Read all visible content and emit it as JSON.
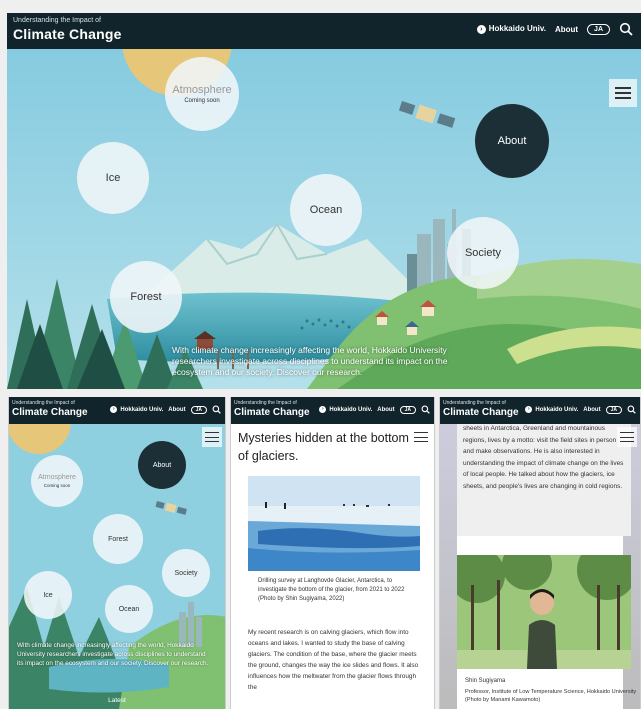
{
  "header": {
    "subtitle": "Understanding the Impact of",
    "title": "Climate Change",
    "nav_hokkaido": "Hokkaido Univ.",
    "nav_about": "About",
    "nav_lang": "JA"
  },
  "hero": {
    "bubbles": {
      "atmosphere": "Atmosphere",
      "coming_soon": "Coming soon",
      "about": "About",
      "ice": "Ice",
      "ocean": "Ocean",
      "society": "Society",
      "forest": "Forest"
    },
    "intro": "With climate change increasingly affecting the world, Hokkaido University researchers investigate across disciplines to understand its impact on the ecosystem and our society. Discover our research."
  },
  "mobile_home": {
    "intro": "With climate change increasingly affecting the world, Hokkaido University researchers investigate across disciplines to understand its impact on the ecosystem and our society. Discover our research.",
    "latest": "Latest"
  },
  "article": {
    "heading": "Mysteries hidden at the bottom of glaciers.",
    "caption": "Drilling survey at Langhovde Glacier, Antarctica, to investigate the bottom of the glacier, from 2021 to 2022 (Photo by Shin Sugiyama, 2022)",
    "body": "My recent research is on calving glaciers, which flow into oceans and lakes. I wanted to study the base of calving glaciers. The condition of the base, where the glacier meets the ground, changes the way the ice slides and flows. It also influences how the meltwater from the glacier flows through the"
  },
  "profile": {
    "quote": "sheets in Antarctica, Greenland and mountainous regions, lives by a motto: visit the field sites in person and make observations. He is also interested in understanding the impact of climate change on the lives of local people. He talked about how the glaciers, ice sheets, and people's lives are changing in cold regions.",
    "name": "Shin Sugiyama",
    "role": "Professor, Institute of Low Temperature Science, Hokkaido University (Photo by Manami Kawamoto)"
  },
  "colors": {
    "header_bg": "#11232b",
    "sky": "#8ecfe0",
    "about_bubble": "#1c2e36"
  }
}
